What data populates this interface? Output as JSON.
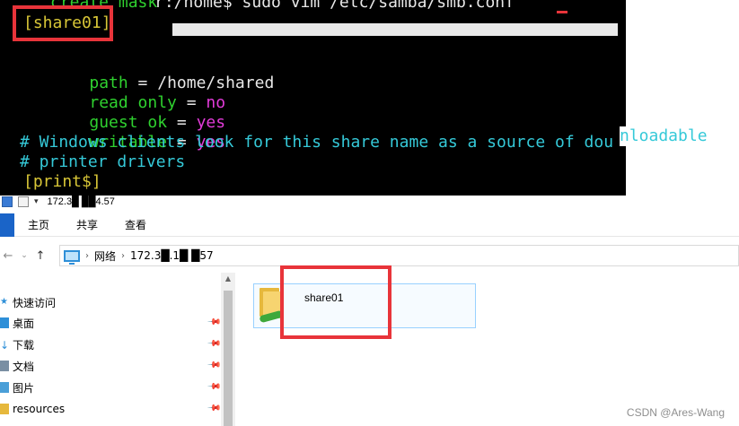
{
  "terminal": {
    "prompt_line_left": "create mask",
    "prompt_line_right": "r:/home$ sudo vim /etc/samba/smb.conf ",
    "cursor": "_",
    "section_header": "[share01]",
    "config": [
      {
        "key": "path",
        "eq": " = ",
        "value": "/home/shared"
      },
      {
        "key": "read only",
        "eq": " = ",
        "value": "no"
      },
      {
        "key": "guest ok",
        "eq": " = ",
        "value": "yes"
      },
      {
        "key": "writable",
        "eq": " = ",
        "value": "yes"
      }
    ],
    "comment_1": "# Windows clients look for this share name as a source of dou",
    "comment_1_overflow": "nloadable",
    "comment_2": "# printer drivers",
    "section_print": "[print$]",
    "colors": {
      "background": "#000000",
      "green": "#2fd12f",
      "magenta": "#e23bd9",
      "cyan": "#35c9d8",
      "yellow": "#d8c637",
      "highlight": "#e8343a"
    }
  },
  "explorer": {
    "window_title": "172.3█ ██4.57",
    "ribbon_tabs": [
      "主页",
      "共享",
      "查看"
    ],
    "address": {
      "root": "网络",
      "host": "172.3█.1█ █57"
    },
    "nav": [
      {
        "label": "快速访问",
        "icon": "star-icon"
      },
      {
        "label": "桌面",
        "icon": "desktop-folder-icon"
      },
      {
        "label": "下载",
        "icon": "download-folder-icon"
      },
      {
        "label": "文档",
        "icon": "documents-folder-icon"
      },
      {
        "label": "图片",
        "icon": "pictures-folder-icon"
      },
      {
        "label": "resources",
        "icon": "folder-icon"
      }
    ],
    "share_item": {
      "name": "share01",
      "icon": "shared-folder-icon"
    },
    "colors": {
      "accent": "#1a64c8",
      "selection": "#99d1ff",
      "highlight": "#e8343a"
    }
  },
  "watermark": "CSDN @Ares-Wang"
}
